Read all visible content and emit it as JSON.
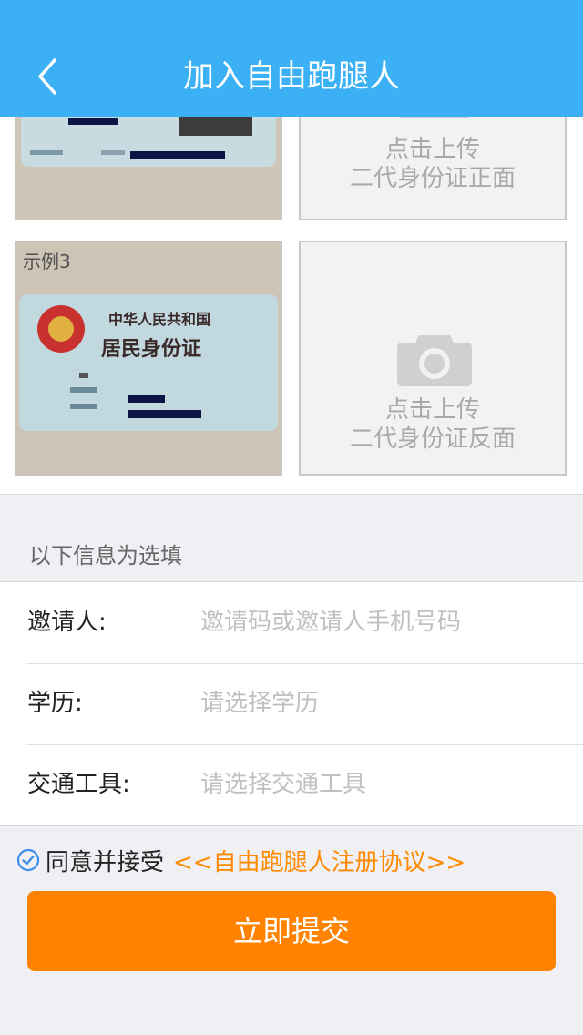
{
  "nav": {
    "title": "加入自由跑腿人",
    "back_icon": "chevron-left-icon"
  },
  "photos": {
    "upload_front": {
      "line1": "点击上传",
      "line2": "二代身份证正面"
    },
    "example3": {
      "label": "示例3",
      "card_title1": "中华人民共和国",
      "card_title2": "居民身份证"
    },
    "upload_back": {
      "line1": "点击上传",
      "line2": "二代身份证反面"
    },
    "camera_icon": "camera-icon"
  },
  "optional_section": {
    "label": "以下信息为选填"
  },
  "form": {
    "inviter": {
      "label": "邀请人:",
      "placeholder": "邀请码或邀请人手机号码",
      "value": ""
    },
    "education": {
      "label": "学历:",
      "placeholder": "请选择学历",
      "value": ""
    },
    "transport": {
      "label": "交通工具:",
      "placeholder": "请选择交通工具",
      "value": ""
    }
  },
  "agreement": {
    "check_icon": "check-circle-icon",
    "text": "同意并接受",
    "link": "<<自由跑腿人注册协议>>",
    "checked": true
  },
  "submit_label": "立即提交",
  "colors": {
    "primary": "#3bb0f5",
    "accent": "#ff8200",
    "link": "#ff8a00"
  }
}
